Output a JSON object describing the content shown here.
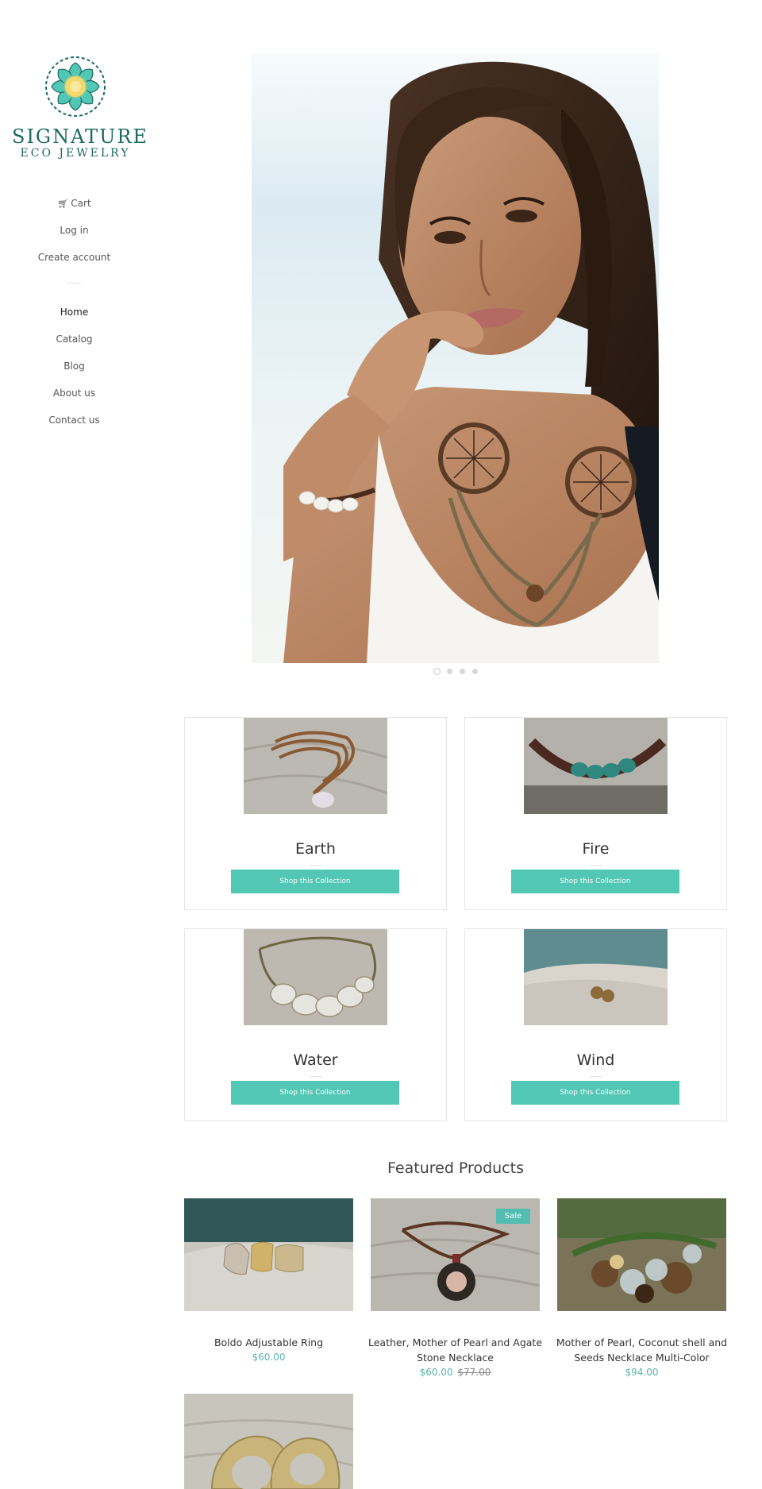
{
  "brand": {
    "name": "SIGNATURE",
    "subtitle": "ECO JEWELRY",
    "colors": {
      "primary": "#1d6a63",
      "petal": "#52c7b5",
      "center": "#f3d86a"
    }
  },
  "sidebar": {
    "account": [
      {
        "label": "Cart",
        "icon": "cart-icon"
      },
      {
        "label": "Log in"
      },
      {
        "label": "Create account"
      }
    ],
    "nav": [
      {
        "label": "Home",
        "active": true
      },
      {
        "label": "Catalog"
      },
      {
        "label": "Blog"
      },
      {
        "label": "About us"
      },
      {
        "label": "Contact us"
      }
    ]
  },
  "slideshow": {
    "slide_count": 4,
    "active_slide": 1
  },
  "collections": [
    {
      "title": "Earth",
      "button": "Shop this Collection"
    },
    {
      "title": "Fire",
      "button": "Shop this Collection"
    },
    {
      "title": "Water",
      "button": "Shop this Collection"
    },
    {
      "title": "Wind",
      "button": "Shop this Collection"
    }
  ],
  "featured": {
    "heading": "Featured Products",
    "products": [
      {
        "title": "Boldo Adjustable Ring",
        "price": "$60.00"
      },
      {
        "title": "Leather, Mother of Pearl and Agate Stone Necklace",
        "price": "$60.00",
        "compare_price": "$77.00",
        "badge": "Sale"
      },
      {
        "title": "Mother of Pearl, Coconut shell and Seeds Necklace Multi-Color",
        "price": "$94.00"
      },
      {
        "title": ""
      }
    ]
  },
  "theme": {
    "accent": "#52c7b5",
    "price": "#5bb3a7",
    "text": "#333333"
  }
}
